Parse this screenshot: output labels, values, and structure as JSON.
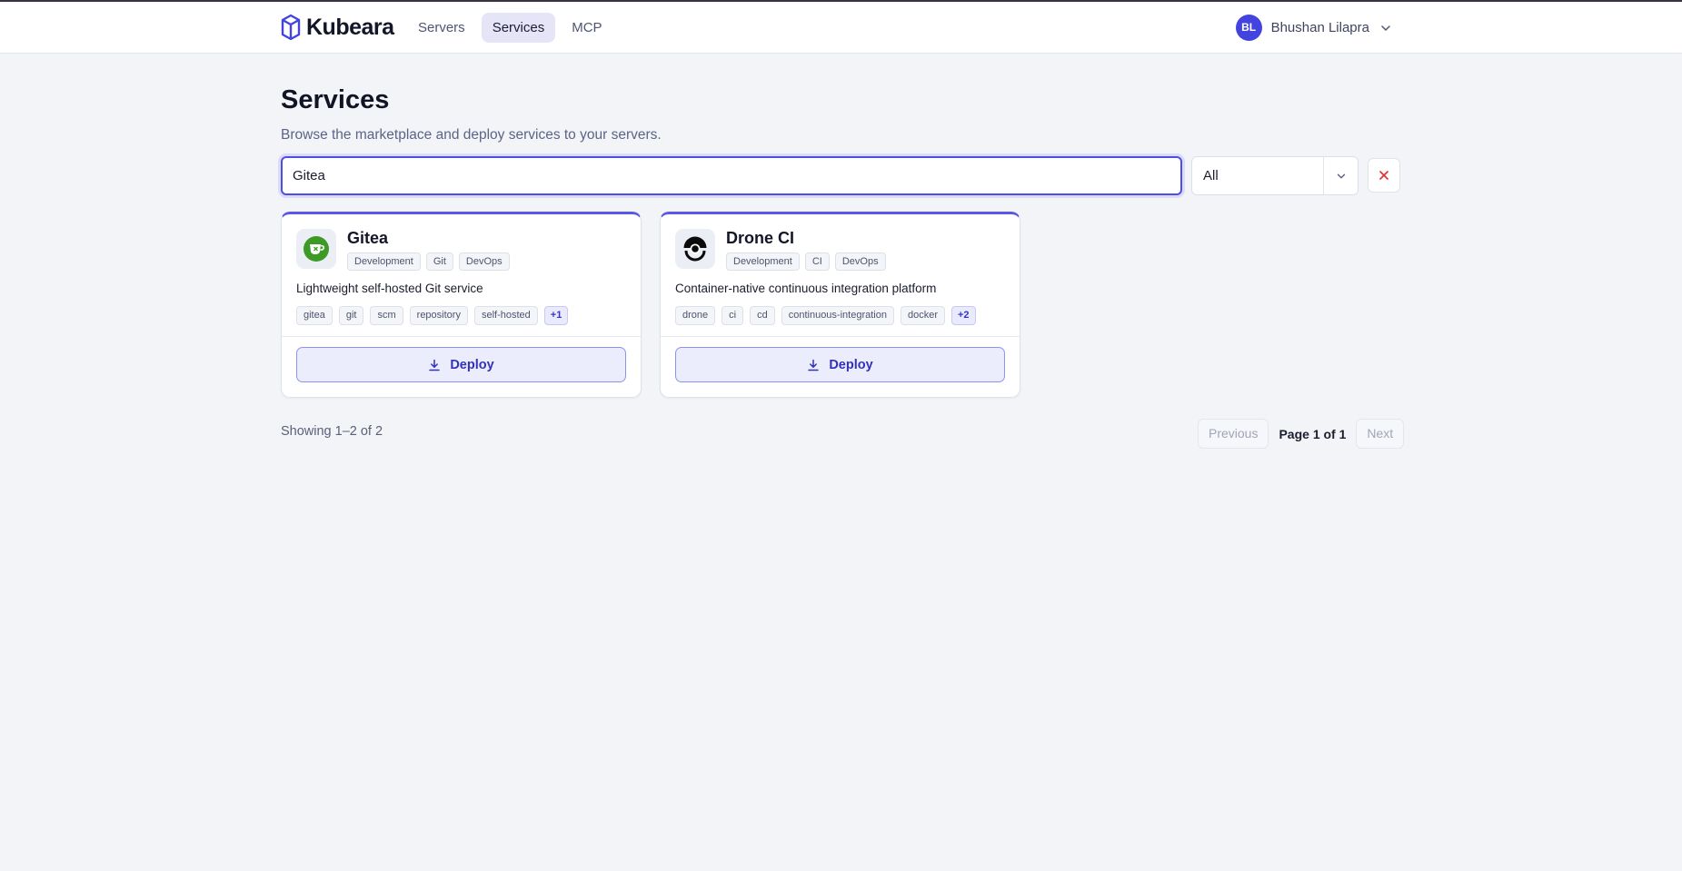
{
  "app": {
    "name": "Kubeara",
    "brand_color": "#4343e0"
  },
  "nav": {
    "items": [
      {
        "label": "Servers",
        "active": false
      },
      {
        "label": "Services",
        "active": true
      },
      {
        "label": "MCP",
        "active": false
      }
    ]
  },
  "user": {
    "initials": "BL",
    "name": "Bhushan Lilapra"
  },
  "page": {
    "title": "Services",
    "subtitle": "Browse the marketplace and deploy services to your servers."
  },
  "search": {
    "value": "Gitea"
  },
  "filter": {
    "selected": "All"
  },
  "services": [
    {
      "name": "Gitea",
      "icon": "gitea-tea-icon",
      "categories": [
        "Development",
        "Git",
        "DevOps"
      ],
      "description": "Lightweight self-hosted Git service",
      "tags": [
        "gitea",
        "git",
        "scm",
        "repository",
        "self-hosted"
      ],
      "more": "+1",
      "action": "Deploy"
    },
    {
      "name": "Drone CI",
      "icon": "drone-icon",
      "categories": [
        "Development",
        "CI",
        "DevOps"
      ],
      "description": "Container-native continuous integration platform",
      "tags": [
        "drone",
        "ci",
        "cd",
        "continuous-integration",
        "docker"
      ],
      "more": "+2",
      "action": "Deploy"
    }
  ],
  "pagination": {
    "summary": "Showing 1–2 of 2",
    "previous": "Previous",
    "info": "Page 1 of 1",
    "next": "Next"
  }
}
